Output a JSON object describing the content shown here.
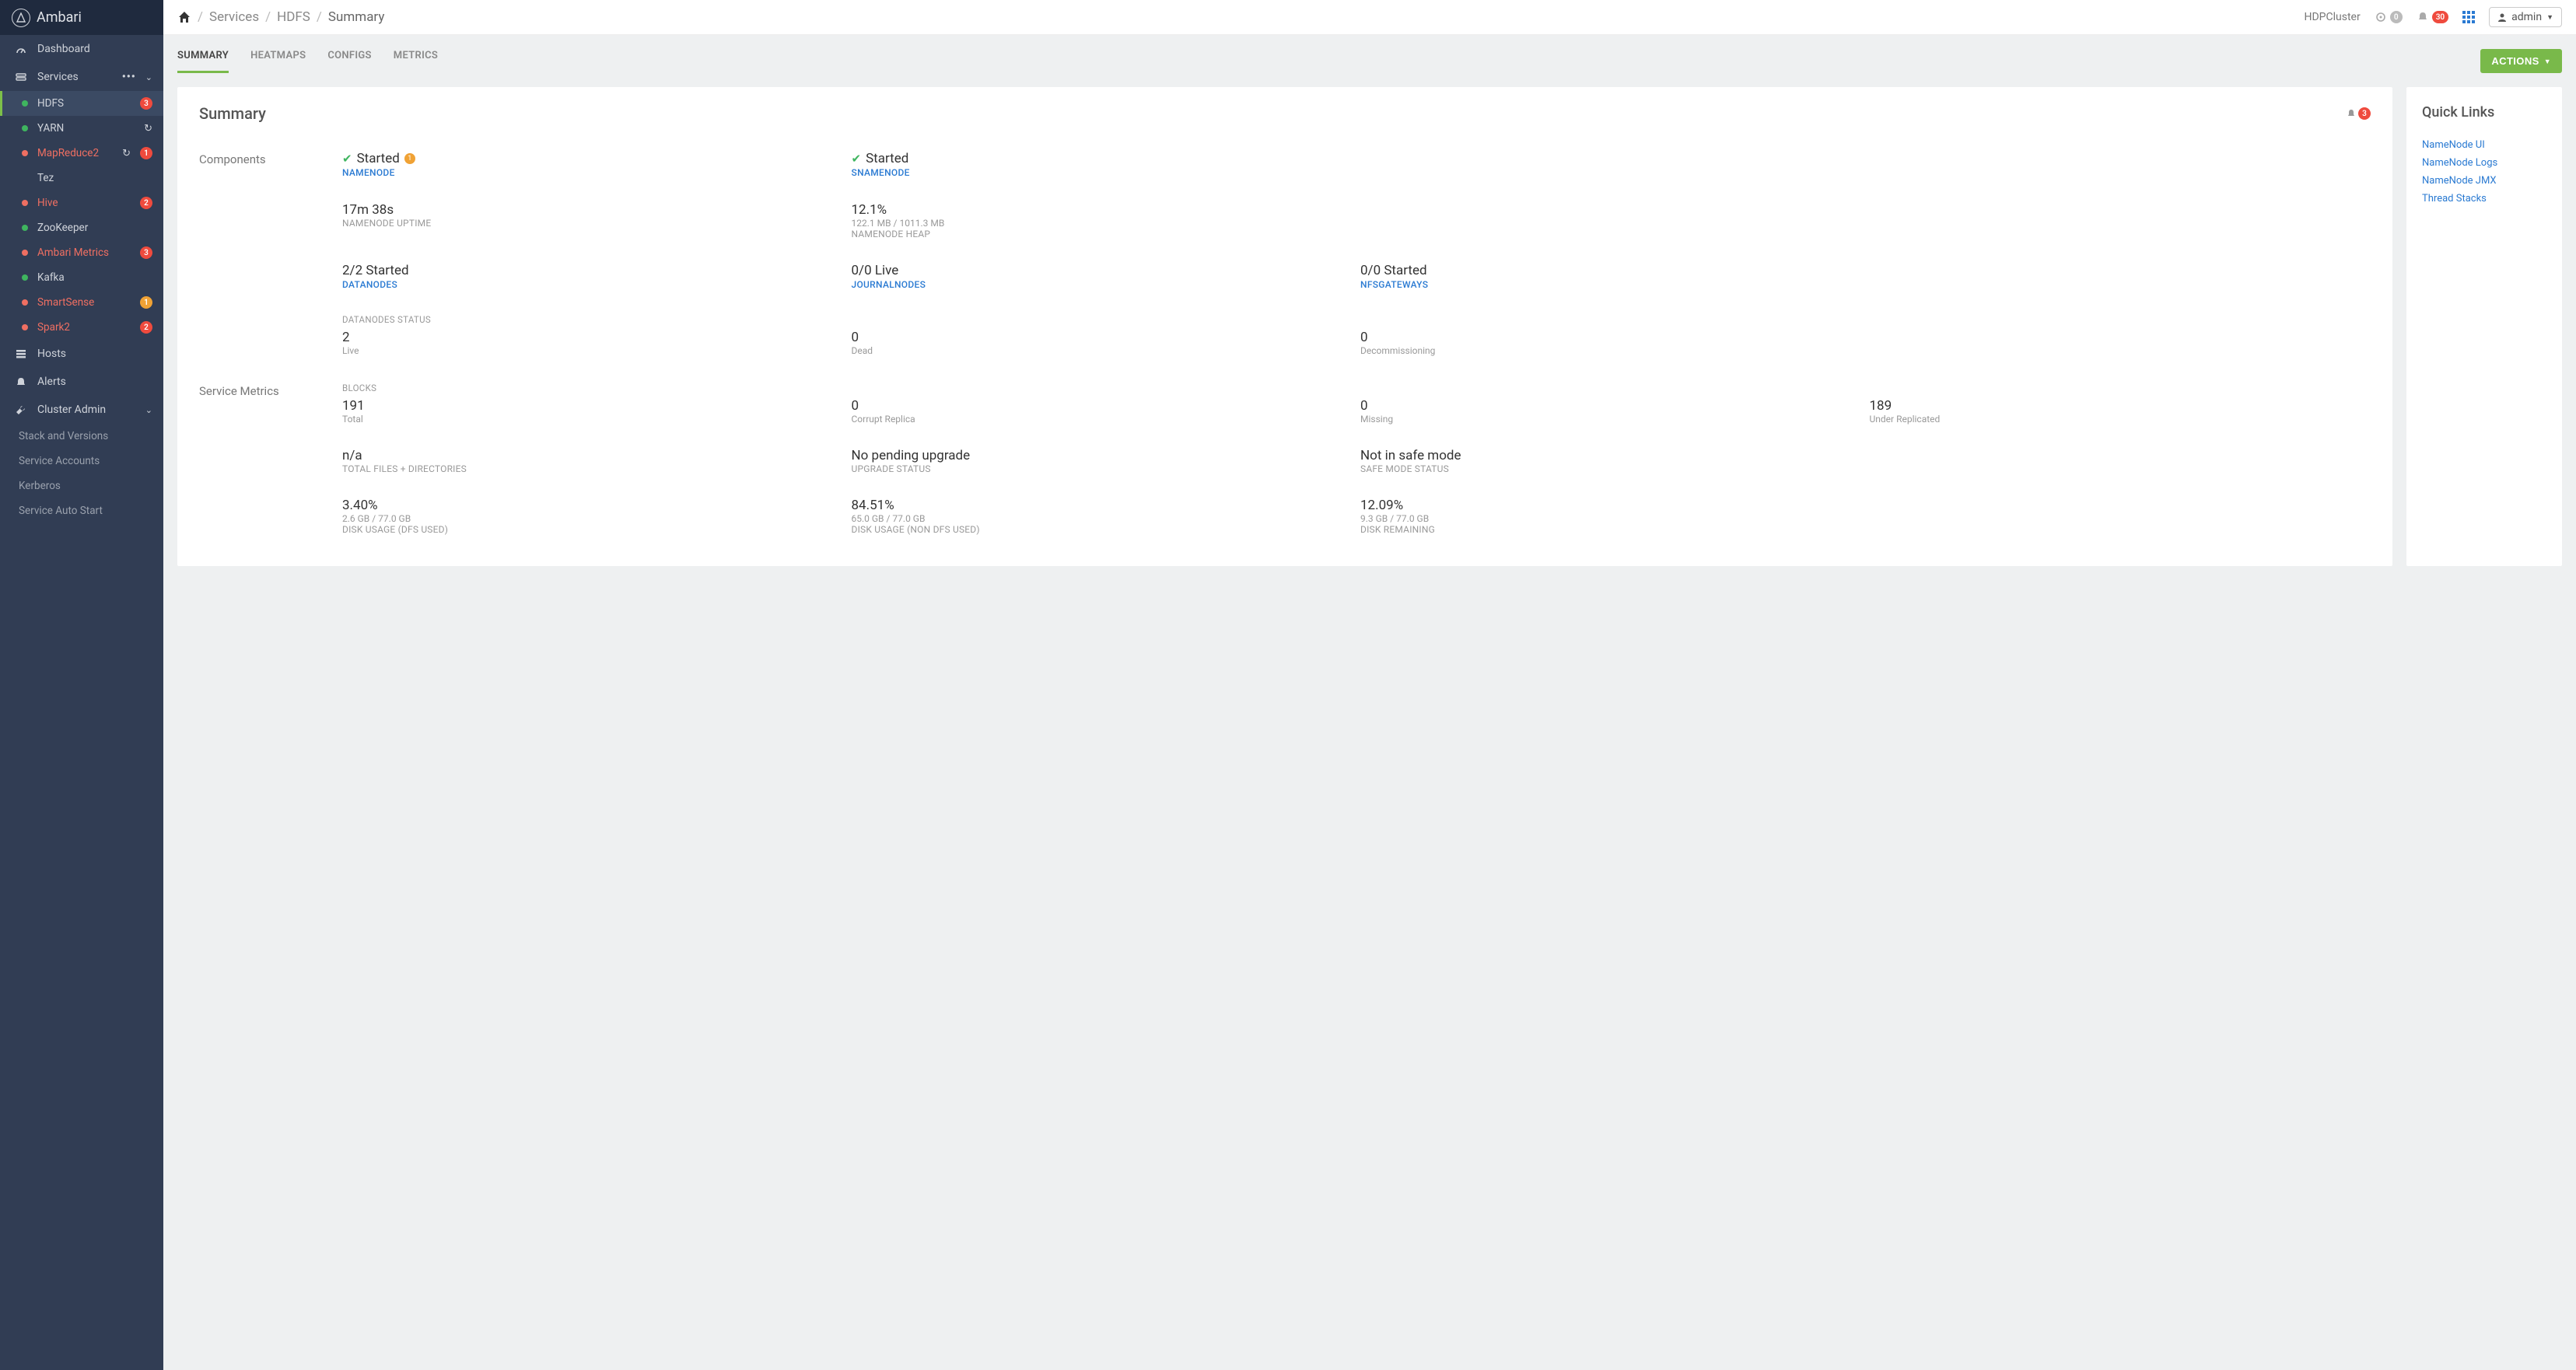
{
  "brand": "Ambari",
  "sidebar": {
    "dashboard": "Dashboard",
    "services_label": "Services",
    "services": [
      {
        "label": "HDFS",
        "dot": "green",
        "active": true,
        "labelRed": false,
        "badge": "3",
        "badgeColor": "red",
        "refresh": false
      },
      {
        "label": "YARN",
        "dot": "green",
        "active": false,
        "labelRed": false,
        "badge": "",
        "badgeColor": "",
        "refresh": true
      },
      {
        "label": "MapReduce2",
        "dot": "red",
        "active": false,
        "labelRed": true,
        "badge": "1",
        "badgeColor": "red",
        "refresh": true
      },
      {
        "label": "Tez",
        "dot": "none",
        "active": false,
        "labelRed": false,
        "badge": "",
        "badgeColor": "",
        "refresh": false
      },
      {
        "label": "Hive",
        "dot": "red",
        "active": false,
        "labelRed": true,
        "badge": "2",
        "badgeColor": "red",
        "refresh": false
      },
      {
        "label": "ZooKeeper",
        "dot": "green",
        "active": false,
        "labelRed": false,
        "badge": "",
        "badgeColor": "",
        "refresh": false
      },
      {
        "label": "Ambari Metrics",
        "dot": "red",
        "active": false,
        "labelRed": true,
        "badge": "3",
        "badgeColor": "red",
        "refresh": false
      },
      {
        "label": "Kafka",
        "dot": "green",
        "active": false,
        "labelRed": false,
        "badge": "",
        "badgeColor": "",
        "refresh": false
      },
      {
        "label": "SmartSense",
        "dot": "red",
        "active": false,
        "labelRed": true,
        "badge": "1",
        "badgeColor": "orange",
        "refresh": false
      },
      {
        "label": "Spark2",
        "dot": "red",
        "active": false,
        "labelRed": true,
        "badge": "2",
        "badgeColor": "red",
        "refresh": false
      }
    ],
    "hosts": "Hosts",
    "alerts": "Alerts",
    "cluster_admin": "Cluster Admin",
    "admin_items": [
      "Stack and Versions",
      "Service Accounts",
      "Kerberos",
      "Service Auto Start"
    ]
  },
  "top": {
    "breadcrumb": [
      "Services",
      "HDFS",
      "Summary"
    ],
    "cluster": "HDPCluster",
    "ops_count": "0",
    "alerts_count": "30",
    "user": "admin"
  },
  "tabs": [
    "SUMMARY",
    "HEATMAPS",
    "CONFIGS",
    "METRICS"
  ],
  "actions_label": "ACTIONS",
  "summary": {
    "title": "Summary",
    "alert_badge": "3",
    "sections": {
      "components_label": "Components",
      "service_metrics_label": "Service Metrics"
    },
    "components": {
      "namenode": {
        "status": "Started",
        "link": "NAMENODE",
        "warn": "1"
      },
      "snamenode": {
        "status": "Started",
        "link": "SNAMENODE"
      },
      "uptime": {
        "value": "17m 38s",
        "label": "NAMENODE UPTIME"
      },
      "heap": {
        "value": "12.1%",
        "sub": "122.1 MB / 1011.3 MB",
        "label": "NAMENODE HEAP"
      },
      "datanodes": {
        "value": "2/2 Started",
        "link": "DATANODES"
      },
      "journal": {
        "value": "0/0 Live",
        "link": "JOURNALNODES"
      },
      "nfs": {
        "value": "0/0 Started",
        "link": "NFSGATEWAYS"
      },
      "dn_status_hdr": "DATANODES STATUS",
      "dn_live": {
        "value": "2",
        "label": "Live"
      },
      "dn_dead": {
        "value": "0",
        "label": "Dead"
      },
      "dn_decom": {
        "value": "0",
        "label": "Decommissioning"
      }
    },
    "metrics": {
      "blocks_hdr": "BLOCKS",
      "total": {
        "value": "191",
        "label": "Total"
      },
      "corrupt": {
        "value": "0",
        "label": "Corrupt Replica"
      },
      "missing": {
        "value": "0",
        "label": "Missing"
      },
      "under": {
        "value": "189",
        "label": "Under Replicated"
      },
      "files": {
        "value": "n/a",
        "label": "TOTAL FILES + DIRECTORIES"
      },
      "upgrade": {
        "value": "No pending upgrade",
        "label": "UPGRADE STATUS"
      },
      "safemode": {
        "value": "Not in safe mode",
        "label": "SAFE MODE STATUS"
      },
      "dfs": {
        "value": "3.40%",
        "sub": "2.6 GB / 77.0 GB",
        "label": "DISK USAGE (DFS USED)"
      },
      "nondfs": {
        "value": "84.51%",
        "sub": "65.0 GB / 77.0 GB",
        "label": "DISK USAGE (NON DFS USED)"
      },
      "remain": {
        "value": "12.09%",
        "sub": "9.3 GB / 77.0 GB",
        "label": "DISK REMAINING"
      }
    }
  },
  "quick_links": {
    "title": "Quick Links",
    "items": [
      "NameNode UI",
      "NameNode Logs",
      "NameNode JMX",
      "Thread Stacks"
    ]
  }
}
